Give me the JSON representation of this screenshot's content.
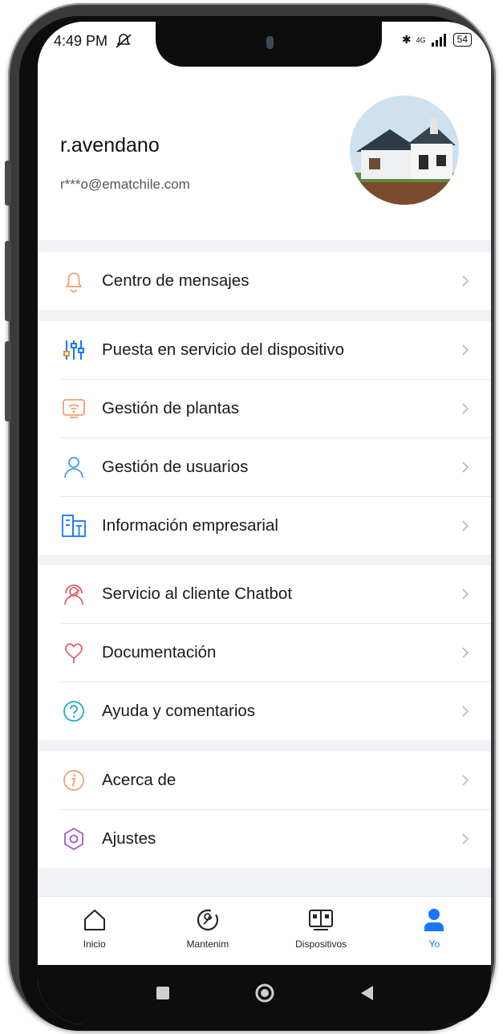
{
  "status_bar": {
    "time": "4:49 PM",
    "network": "4G",
    "battery": "54"
  },
  "profile": {
    "username": "r.avendano",
    "email": "r***o@ematchile.com"
  },
  "menu_groups": [
    [
      {
        "label": "Centro de mensajes",
        "icon": "bell-icon"
      }
    ],
    [
      {
        "label": "Puesta en servicio del dispositivo",
        "icon": "sliders-icon"
      },
      {
        "label": "Gestión de plantas",
        "icon": "plant-icon"
      },
      {
        "label": "Gestión de usuarios",
        "icon": "user-icon"
      },
      {
        "label": "Información empresarial",
        "icon": "building-icon"
      }
    ],
    [
      {
        "label": "Servicio al cliente Chatbot",
        "icon": "headset-icon"
      },
      {
        "label": "Documentación",
        "icon": "document-icon"
      },
      {
        "label": "Ayuda y comentarios",
        "icon": "help-icon"
      }
    ],
    [
      {
        "label": "Acerca de",
        "icon": "info-icon"
      },
      {
        "label": "Ajustes",
        "icon": "settings-icon"
      }
    ]
  ],
  "bottom_nav": [
    {
      "label": "Inicio",
      "icon": "home-icon",
      "active": false
    },
    {
      "label": "Mantenim",
      "icon": "maintenance-icon",
      "active": false
    },
    {
      "label": "Dispositivos",
      "icon": "devices-icon",
      "active": false
    },
    {
      "label": "Yo",
      "icon": "person-icon",
      "active": true
    }
  ],
  "colors": {
    "accent": "#1677ff",
    "page_bg": "#f1f2f5",
    "text": "#1a1a1a"
  }
}
